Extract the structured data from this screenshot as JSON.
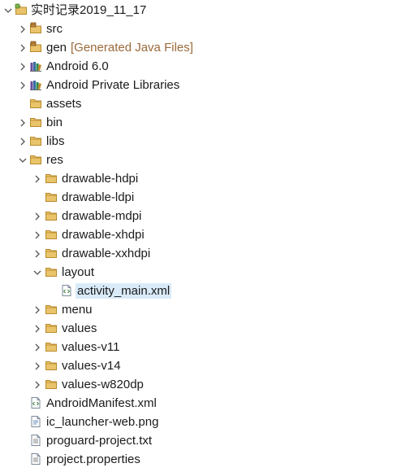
{
  "tree": [
    {
      "label": "实时记录2019_11_17",
      "icon": "project-icon",
      "expand": "open",
      "level": 0
    },
    {
      "label": "src",
      "icon": "package-folder-icon",
      "expand": "closed",
      "level": 1
    },
    {
      "label": "gen",
      "decoration": "[Generated Java Files]",
      "icon": "package-folder-icon",
      "expand": "closed",
      "level": 1
    },
    {
      "label": "Android 6.0",
      "icon": "library-icon",
      "expand": "closed",
      "level": 1
    },
    {
      "label": "Android Private Libraries",
      "icon": "library-icon",
      "expand": "closed",
      "level": 1
    },
    {
      "label": "assets",
      "icon": "folder-icon",
      "expand": "none",
      "level": 1
    },
    {
      "label": "bin",
      "icon": "folder-icon",
      "expand": "closed",
      "level": 1
    },
    {
      "label": "libs",
      "icon": "folder-icon",
      "expand": "closed",
      "level": 1
    },
    {
      "label": "res",
      "icon": "folder-icon",
      "expand": "open",
      "level": 1
    },
    {
      "label": "drawable-hdpi",
      "icon": "folder-icon",
      "expand": "closed",
      "level": 2
    },
    {
      "label": "drawable-ldpi",
      "icon": "folder-icon",
      "expand": "none",
      "level": 2
    },
    {
      "label": "drawable-mdpi",
      "icon": "folder-icon",
      "expand": "closed",
      "level": 2
    },
    {
      "label": "drawable-xhdpi",
      "icon": "folder-icon",
      "expand": "closed",
      "level": 2
    },
    {
      "label": "drawable-xxhdpi",
      "icon": "folder-icon",
      "expand": "closed",
      "level": 2
    },
    {
      "label": "layout",
      "icon": "folder-icon",
      "expand": "open",
      "level": 2
    },
    {
      "label": "activity_main.xml",
      "icon": "xml-file-icon",
      "expand": "none",
      "level": 3,
      "selected": true
    },
    {
      "label": "menu",
      "icon": "folder-icon",
      "expand": "closed",
      "level": 2
    },
    {
      "label": "values",
      "icon": "folder-icon",
      "expand": "closed",
      "level": 2
    },
    {
      "label": "values-v11",
      "icon": "folder-icon",
      "expand": "closed",
      "level": 2
    },
    {
      "label": "values-v14",
      "icon": "folder-icon",
      "expand": "closed",
      "level": 2
    },
    {
      "label": "values-w820dp",
      "icon": "folder-icon",
      "expand": "closed",
      "level": 2
    },
    {
      "label": "AndroidManifest.xml",
      "icon": "xml-file-icon",
      "expand": "none",
      "level": 1
    },
    {
      "label": "ic_launcher-web.png",
      "icon": "image-file-icon",
      "expand": "none",
      "level": 1
    },
    {
      "label": "proguard-project.txt",
      "icon": "text-file-icon",
      "expand": "none",
      "level": 1
    },
    {
      "label": "project.properties",
      "icon": "text-file-icon",
      "expand": "none",
      "level": 1
    }
  ],
  "colors": {
    "folder_fill": "#e9c46a",
    "folder_stroke": "#b98a2c",
    "selection": "#d9ebf9",
    "decoration_text": "#9b6a3a",
    "chevron": "#555555"
  }
}
